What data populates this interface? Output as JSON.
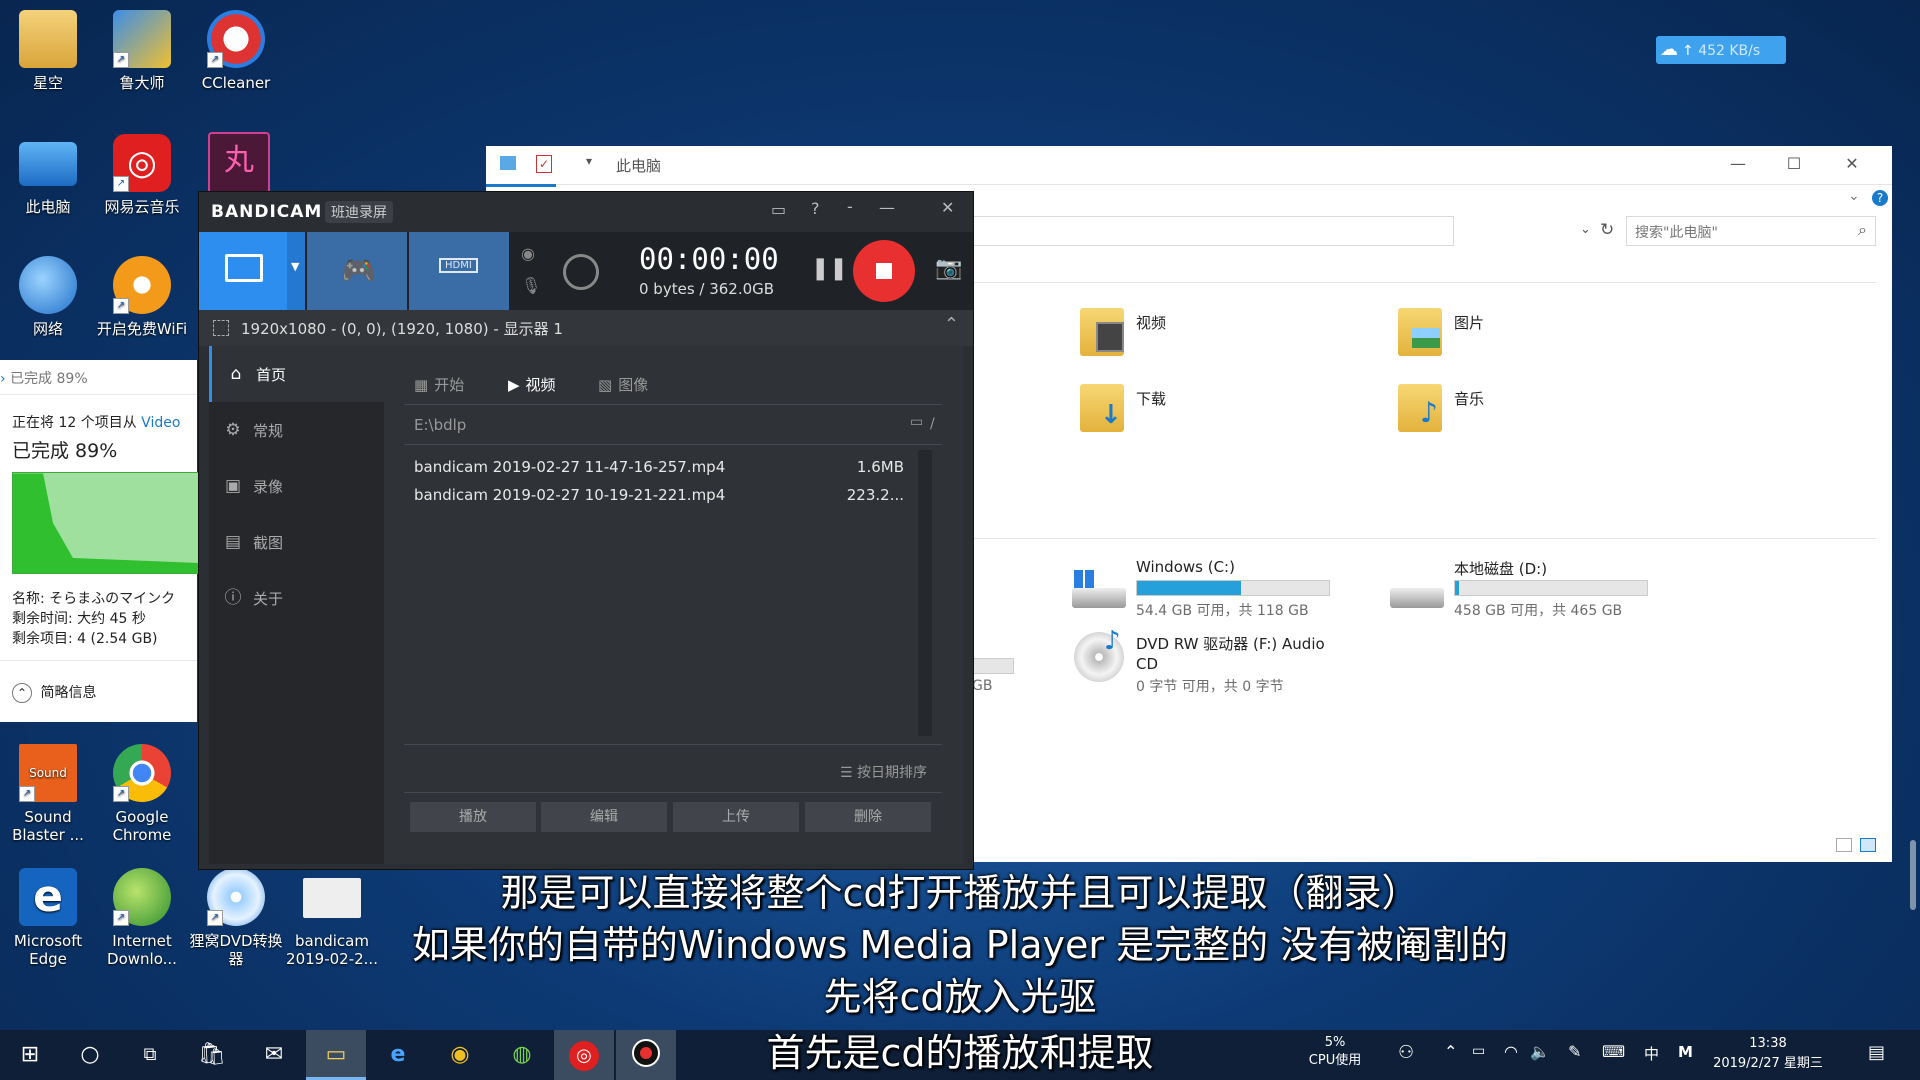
{
  "desktop": {
    "icons_top": [
      {
        "label": "星空"
      },
      {
        "label": "鲁大师"
      },
      {
        "label": "CCleaner"
      },
      {
        "label": "此电脑"
      },
      {
        "label": "网易云音乐"
      },
      {
        "label": "网络"
      },
      {
        "label": "开启免费WiFi"
      }
    ],
    "icons_bottom": [
      {
        "label": "Sound Blaster ..."
      },
      {
        "label": "Google Chrome"
      },
      {
        "label": "Microsoft Edge"
      },
      {
        "label": "Internet Downlo..."
      },
      {
        "label": "狸窝DVD转换器"
      },
      {
        "label": "bandicam 2019-02-2..."
      }
    ],
    "net_speed": "452 KB/s"
  },
  "explorer": {
    "title": "此电脑",
    "search_placeholder": "搜索\"此电脑\"",
    "folders": [
      "视频",
      "图片",
      "下载",
      "音乐"
    ],
    "drives": [
      {
        "name": "Windows (C:)",
        "info": "54.4 GB 可用，共 118 GB",
        "used_fraction": 0.54
      },
      {
        "name": "本地磁盘 (D:)",
        "info": "458 GB 可用，共 465 GB",
        "used_fraction": 0.02
      },
      {
        "name": "DVD RW 驱动器 (F:) Audio CD",
        "info": "0 字节 可用，共 0 字节"
      }
    ],
    "partial_text": "GB"
  },
  "copy_progress": {
    "header": "已完成 89%",
    "line1_prefix": "正在将 12 个项目从",
    "line1_link": "Video",
    "percent": "已完成 89%",
    "name": "名称: そらまふのマインク",
    "time_left": "剩余时间: 大约 45 秒",
    "items_left": "剩余项目: 4 (2.54 GB)",
    "details": "简略信息"
  },
  "bandicam": {
    "logo": "BANDICAM",
    "logo_cn": "班迪录屏",
    "timer": "00:00:00",
    "size": "0 bytes / 362.0GB",
    "mode": "1920x1080 - (0, 0), (1920, 1080) - 显示器 1",
    "sidebar": [
      "首页",
      "常规",
      "录像",
      "截图",
      "关于"
    ],
    "tabs": [
      "开始",
      "视频",
      "图像"
    ],
    "path": "E:\\bdlp",
    "path_sep": "/",
    "files": [
      {
        "name": "bandicam 2019-02-27 11-47-16-257.mp4",
        "size": "1.6MB"
      },
      {
        "name": "bandicam 2019-02-27 10-19-21-221.mp4",
        "size": "223.2..."
      }
    ],
    "sort": "按日期排序",
    "actions": [
      "播放",
      "编辑",
      "上传",
      "删除"
    ]
  },
  "subtitles": [
    "那是可以直接将整个cd打开播放并且可以提取（翻录）",
    "如果你的自带的Windows Media Player 是完整的 没有被阉割的",
    "先将cd放入光驱",
    "首先是cd的播放和提取"
  ],
  "taskbar": {
    "cpu_pct": "5%",
    "cpu_label": "CPU使用",
    "ime": "中",
    "ime2": "M",
    "time": "13:38",
    "date": "2019/2/27 星期三"
  }
}
